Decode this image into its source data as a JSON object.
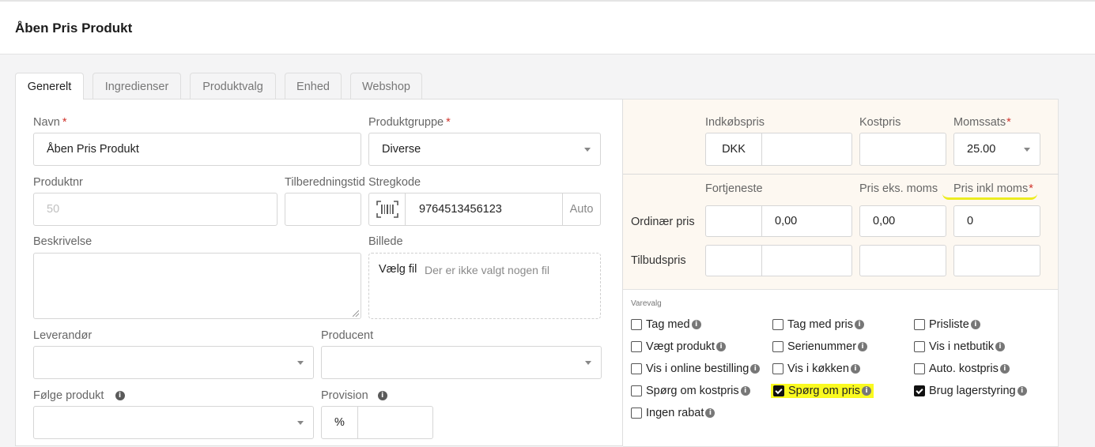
{
  "page": {
    "title": "Åben Pris Produkt"
  },
  "tabs": [
    {
      "label": "Generelt"
    },
    {
      "label": "Ingredienser"
    },
    {
      "label": "Produktvalg"
    },
    {
      "label": "Enhed"
    },
    {
      "label": "Webshop"
    }
  ],
  "form": {
    "navn": {
      "label": "Navn",
      "required": "*",
      "value": "Åben Pris Produkt"
    },
    "produktgruppe": {
      "label": "Produktgruppe",
      "required": "*",
      "value": "Diverse"
    },
    "produktnr": {
      "label": "Produktnr",
      "placeholder": "50"
    },
    "tilberedningstid": {
      "label": "Tilberedningstid",
      "value": ""
    },
    "stregkode": {
      "label": "Stregkode",
      "value": "9764513456123",
      "auto_label": "Auto"
    },
    "beskrivelse": {
      "label": "Beskrivelse",
      "value": ""
    },
    "billede": {
      "label": "Billede",
      "button": "Vælg fil",
      "status": "Der er ikke valgt nogen fil"
    },
    "leverandor": {
      "label": "Leverandør",
      "value": ""
    },
    "producent": {
      "label": "Producent",
      "value": ""
    },
    "folge_produkt": {
      "label": "Følge produkt",
      "value": ""
    },
    "provision": {
      "label": "Provision",
      "unit": "%",
      "value": ""
    }
  },
  "pricing": {
    "indkobspris": {
      "label": "Indkøbspris",
      "currency": "DKK",
      "value": ""
    },
    "kostpris": {
      "label": "Kostpris",
      "value": ""
    },
    "momssats": {
      "label": "Momssats",
      "required": "*",
      "value": "25.00"
    },
    "headers": {
      "fortjeneste": "Fortjeneste",
      "pris_eks_moms": "Pris eks. moms",
      "pris_inkl_moms": "Pris inkl moms",
      "pris_inkl_moms_required": "*"
    },
    "rows": [
      {
        "label": "Ordinær pris",
        "fortjeneste_a": "",
        "fortjeneste_b": "0,00",
        "eks_moms": "0,00",
        "inkl_moms": "0"
      },
      {
        "label": "Tilbudspris",
        "fortjeneste_a": "",
        "fortjeneste_b": "",
        "eks_moms": "",
        "inkl_moms": ""
      }
    ]
  },
  "varevalg": {
    "title": "Varevalg",
    "options": [
      {
        "label": "Tag med",
        "checked": false
      },
      {
        "label": "Tag med pris",
        "checked": false
      },
      {
        "label": "Prisliste",
        "checked": false
      },
      {
        "label": "Vægt produkt",
        "checked": false
      },
      {
        "label": "Serienummer",
        "checked": false
      },
      {
        "label": "Vis i netbutik",
        "checked": false
      },
      {
        "label": "Vis i online bestilling",
        "checked": false
      },
      {
        "label": "Vis i køkken",
        "checked": false
      },
      {
        "label": "Auto. kostpris",
        "checked": false
      },
      {
        "label": "Spørg om kostpris",
        "checked": false
      },
      {
        "label": "Spørg om pris",
        "checked": true
      },
      {
        "label": "Brug lagerstyring",
        "checked": true
      },
      {
        "label": "Ingen rabat",
        "checked": false
      }
    ]
  },
  "icons": {
    "info": "i"
  }
}
